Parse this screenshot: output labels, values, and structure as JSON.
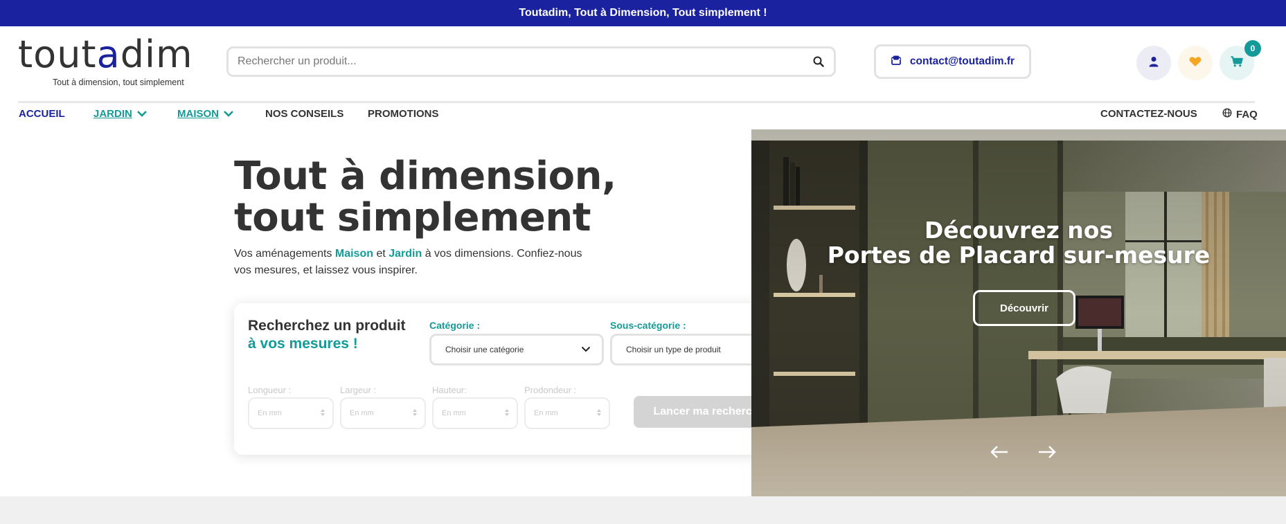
{
  "promo_bar": {
    "text": "Toutadim, Tout à Dimension, Tout simplement !"
  },
  "header": {
    "logo": {
      "word_start": "tout",
      "word_accent": "a",
      "word_end": "dim",
      "tagline": "Tout à dimension, tout simplement"
    },
    "search": {
      "placeholder": "Rechercher un produit...",
      "value": ""
    },
    "contact_email": "contact@toutadim.fr",
    "cart_count": "0"
  },
  "nav": {
    "items": [
      {
        "label": "ACCUEIL"
      },
      {
        "label": "JARDIN"
      },
      {
        "label": "MAISON"
      },
      {
        "label": "NOS CONSEILS"
      },
      {
        "label": "PROMOTIONS"
      }
    ],
    "right": [
      {
        "label": "CONTACTEZ-NOUS"
      },
      {
        "label": "FAQ"
      }
    ]
  },
  "hero": {
    "title_line1": "Tout à dimension,",
    "title_line2": "tout simplement",
    "desc_pre": "Vos aménagements ",
    "desc_maison": "Maison",
    "desc_mid": " et ",
    "desc_jardin": "Jardin",
    "desc_post": " à vos dimensions. Confiez-nous vos mesures, et laissez vous inspirer."
  },
  "search_card": {
    "title_line1": "Recherchez un produit",
    "title_line2": "à vos mesures !",
    "category_label": "Catégorie :",
    "category_value": "Choisir une catégorie",
    "subcategory_label": "Sous-catégorie :",
    "subcategory_value": "Choisir un type de produit",
    "dimensions": [
      {
        "label": "Longueur :",
        "placeholder": "En mm"
      },
      {
        "label": "Largeur :",
        "placeholder": "En mm"
      },
      {
        "label": "Hauteur:",
        "placeholder": "En mm"
      },
      {
        "label": "Prodondeur :",
        "placeholder": "En mm"
      }
    ],
    "submit_label": "Lancer ma recherche"
  },
  "banner": {
    "line1": "Découvrez nos",
    "line2": "Portes de Placard sur-mesure",
    "button_label": "Découvrir"
  },
  "colors": {
    "brand_blue": "#1a22a0",
    "teal": "#149a98",
    "heart": "#f5a623"
  },
  "icons": [
    "search-icon",
    "mail-icon",
    "user-icon",
    "heart-icon",
    "cart-icon",
    "chevron-down-icon",
    "globe-icon",
    "arrow-left-icon",
    "arrow-right-icon",
    "spinner-icon"
  ]
}
